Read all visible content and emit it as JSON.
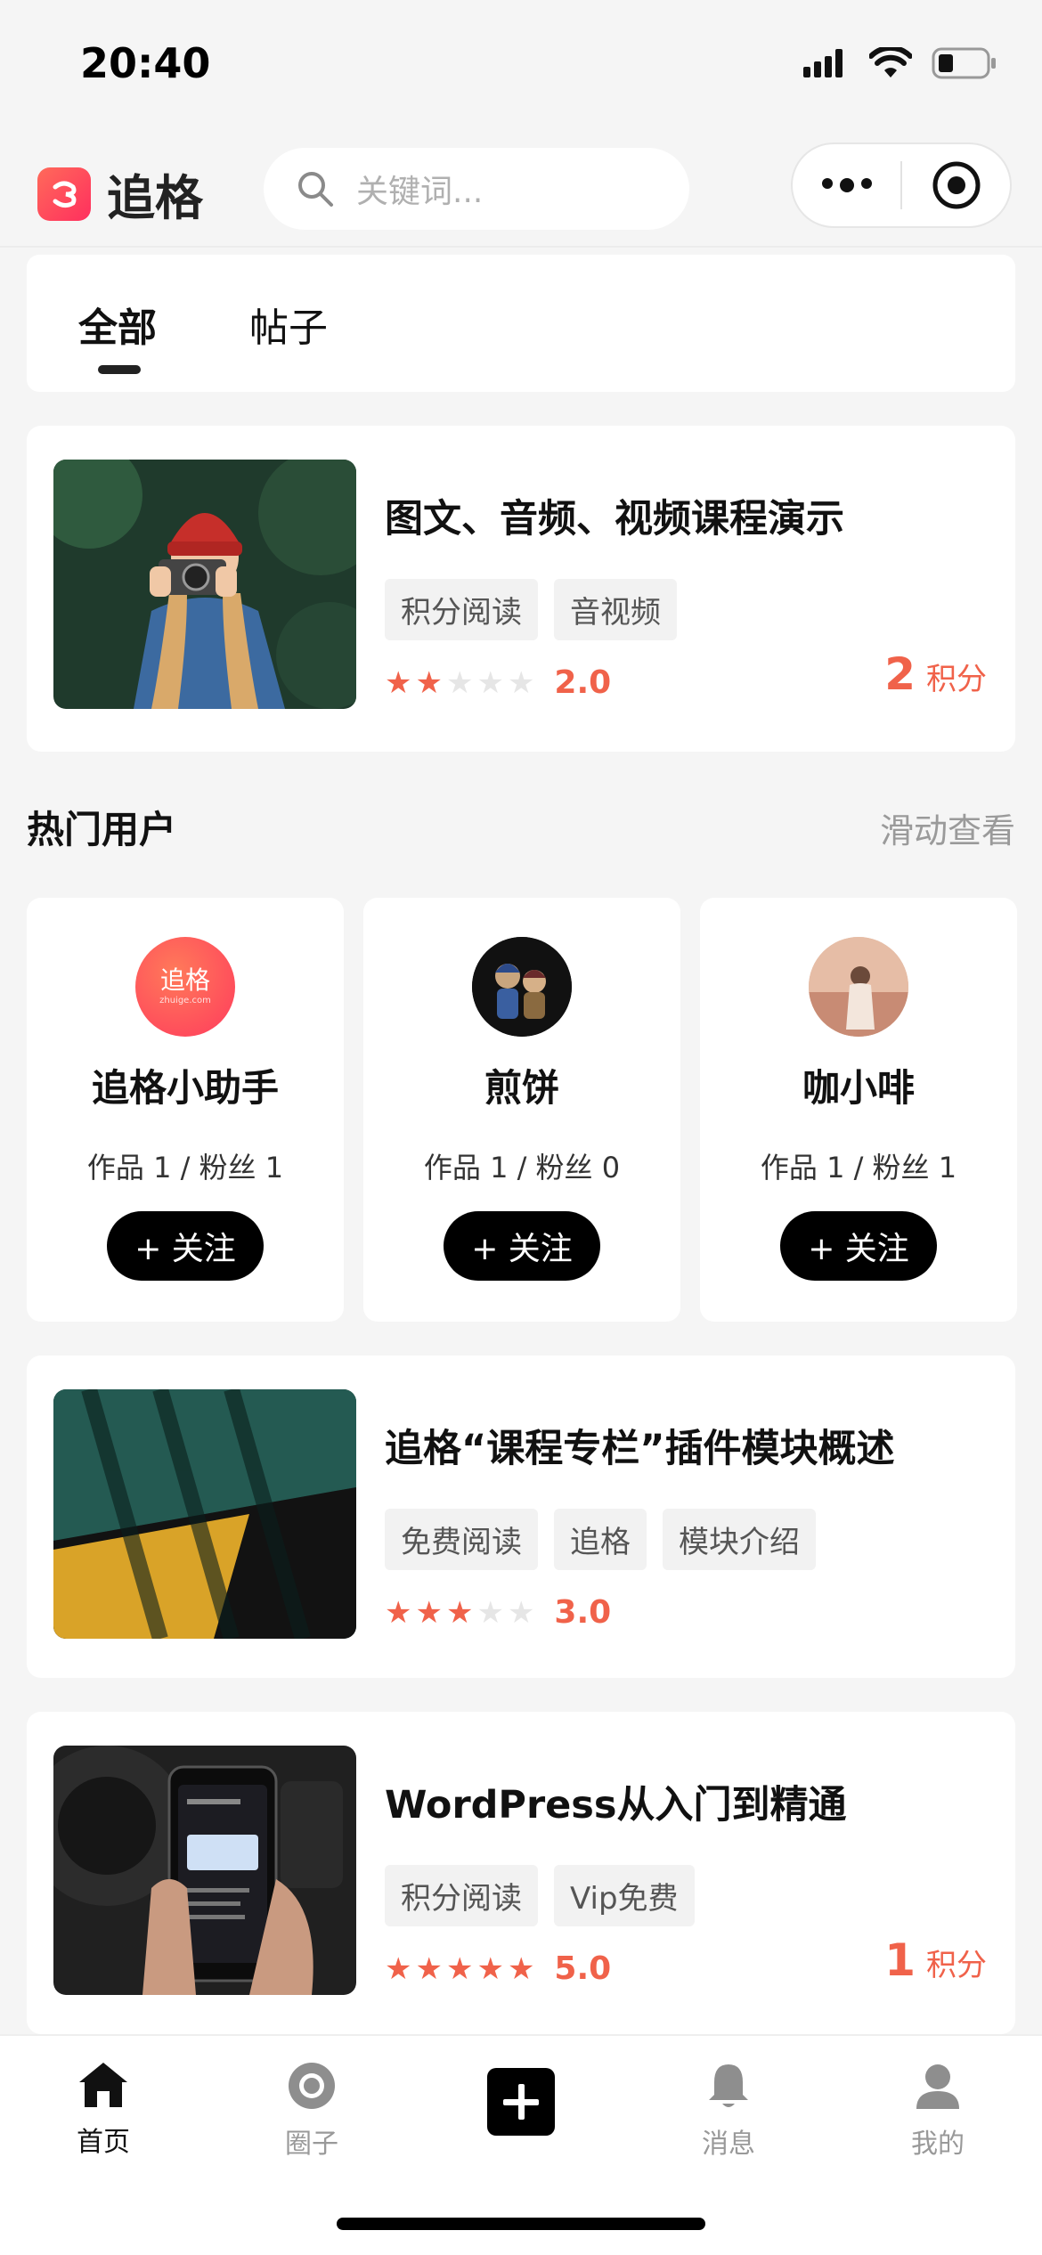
{
  "status_bar": {
    "time": "20:40"
  },
  "header": {
    "logo_text": "追格",
    "search_placeholder": "关键词..."
  },
  "tabs": [
    {
      "label": "全部",
      "active": true
    },
    {
      "label": "帖子",
      "active": false
    }
  ],
  "courses": [
    {
      "title": "图文、音频、视频课程演示",
      "tags": [
        "积分阅读",
        "音视频"
      ],
      "rating": "2.0",
      "stars": 2,
      "points": "2",
      "points_unit": "积分"
    },
    {
      "title": "追格“课程专栏”插件模块概述",
      "tags": [
        "免费阅读",
        "追格",
        "模块介绍"
      ],
      "rating": "3.0",
      "stars": 3
    },
    {
      "title": "WordPress从入门到精通",
      "tags": [
        "积分阅读",
        "Vip免费"
      ],
      "rating": "5.0",
      "stars": 5,
      "points": "1",
      "points_unit": "积分"
    }
  ],
  "hot_users": {
    "title": "热门用户",
    "more": "滑动查看",
    "users": [
      {
        "name": "追格小助手",
        "stats": "作品 1 / 粉丝 1",
        "follow": "+ 关注",
        "avatar_text": "追格",
        "avatar_sub": "zhuige.com"
      },
      {
        "name": "煎饼",
        "stats": "作品 1 / 粉丝 0",
        "follow": "+ 关注"
      },
      {
        "name": "咖小啡",
        "stats": "作品 1 / 粉丝 1",
        "follow": "+ 关注"
      }
    ]
  },
  "tabbar": [
    {
      "label": "首页",
      "icon": "home-icon",
      "active": true
    },
    {
      "label": "圈子",
      "icon": "circle-icon",
      "active": false
    },
    {
      "label": "",
      "icon": "plus-icon",
      "active": false
    },
    {
      "label": "消息",
      "icon": "bell-icon",
      "active": false
    },
    {
      "label": "我的",
      "icon": "user-icon",
      "active": false
    }
  ],
  "colors": {
    "accent": "#f0624a",
    "brand": "#ff3b5c",
    "background": "#f5f5f5"
  }
}
